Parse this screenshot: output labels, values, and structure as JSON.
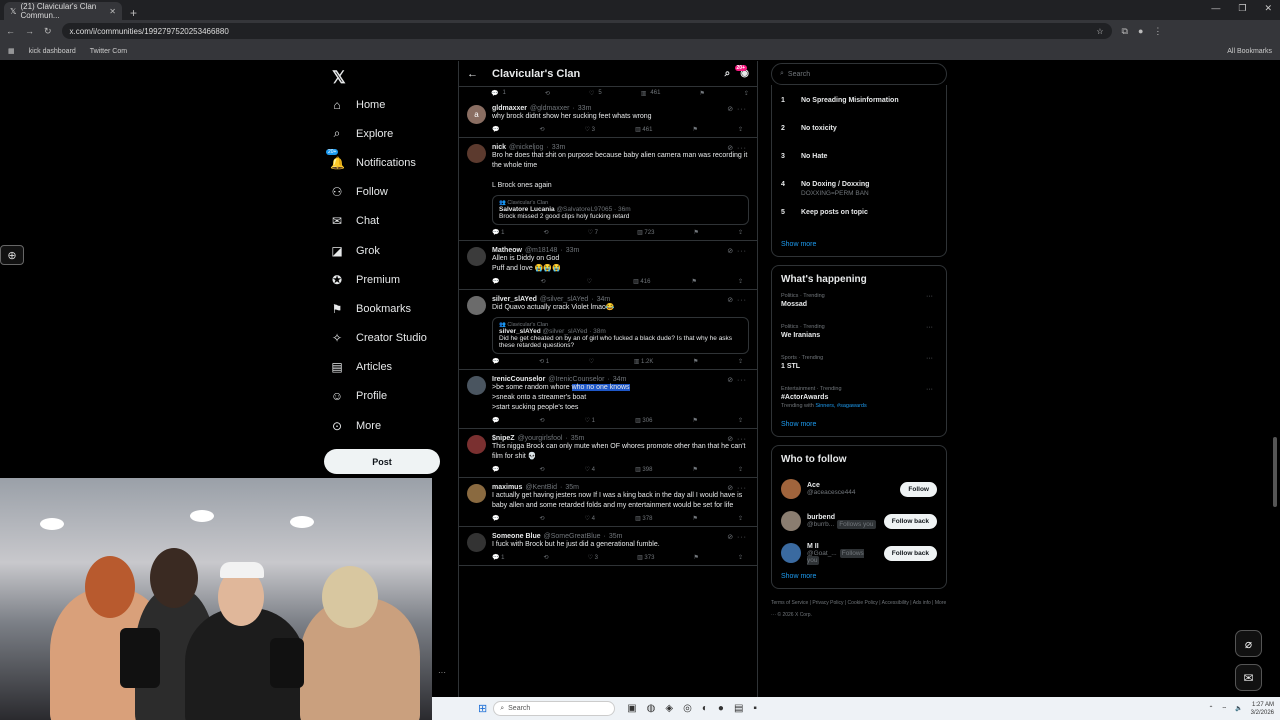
{
  "browser": {
    "tab_title": "(21) Clavicular's Clan Commun...",
    "url": "x.com/i/communities/1992797520253466880",
    "bookmarks": [
      "kick dashboard",
      "Twitter Com"
    ],
    "all_bookmarks": "All Bookmarks"
  },
  "nav": {
    "items": [
      {
        "label": "Home",
        "icon": "home-icon"
      },
      {
        "label": "Explore",
        "icon": "search-icon"
      },
      {
        "label": "Notifications",
        "icon": "bell-icon",
        "badge": "20+"
      },
      {
        "label": "Follow",
        "icon": "person-plus-icon"
      },
      {
        "label": "Chat",
        "icon": "mail-icon"
      },
      {
        "label": "Grok",
        "icon": "grok-icon"
      },
      {
        "label": "Premium",
        "icon": "premium-icon"
      },
      {
        "label": "Bookmarks",
        "icon": "bookmark-icon"
      },
      {
        "label": "Creator Studio",
        "icon": "lightbulb-icon"
      },
      {
        "label": "Articles",
        "icon": "article-icon"
      },
      {
        "label": "Profile",
        "icon": "person-icon"
      },
      {
        "label": "More",
        "icon": "more-icon"
      }
    ],
    "post_label": "Post"
  },
  "feed": {
    "title": "Clavicular's Clan",
    "hot_badge": "20+",
    "top_actions": {
      "replies": "1",
      "likes": "5",
      "views": "461"
    },
    "tweets": [
      {
        "name": "gldmaxxer",
        "handle": "@gldmaxxer",
        "time": "33m",
        "text": "why brock didnt show her sucking feet whats wrong",
        "avatar_letter": "a",
        "avatar_color": "#8a6e62",
        "replies": "",
        "reposts": "",
        "likes": "3",
        "views": "461"
      },
      {
        "name": "nick",
        "handle": "@nickeljog",
        "time": "33m",
        "text": "Bro he does that shit on purpose because baby alien camera man was recording it the whole time\n\nL Brock ones again",
        "avatar_letter": "",
        "avatar_color": "#5c3a2e",
        "quote": {
          "community": "Clavicular's Clan",
          "name": "Salvatore Lucania",
          "handle": "@SalvatoreL97065",
          "time": "36m",
          "text": "Brock missed 2 good clips holy fucking retard"
        },
        "replies": "1",
        "reposts": "",
        "likes": "7",
        "views": "723"
      },
      {
        "name": "Matheow",
        "handle": "@m18148",
        "time": "33m",
        "text": "Allen is Diddy on God\nPuff and love 😭😭😭",
        "avatar_letter": "",
        "avatar_color": "#3b3b3b",
        "replies": "",
        "reposts": "",
        "likes": "",
        "views": "416"
      },
      {
        "name": "silver_slAYed",
        "handle": "@silver_slAYed",
        "time": "34m",
        "text": "Did Quavo actually crack Violet lmao😂",
        "avatar_letter": "",
        "avatar_color": "#6b6b6b",
        "quote": {
          "community": "Clavicular's Clan",
          "name": "silver_slAYed",
          "handle": "@silver_slAYed",
          "time": "38m",
          "text": "Did he get cheated on by an of girl who fucked a black dude? Is that why he asks these retarded questions?"
        },
        "replies": "",
        "reposts": "1",
        "likes": "",
        "views": "1.2K"
      },
      {
        "name": "IrenicCounselor",
        "handle": "@IrenicCounselor",
        "time": "34m",
        "text_pre": ">be some random whore ",
        "text_hl": "who no one knows",
        "text_post": "\n>sneak onto a streamer's boat\n>start sucking people's toes",
        "avatar_letter": "",
        "avatar_color": "#4a5560",
        "replies": "",
        "reposts": "",
        "likes": "1",
        "views": "306"
      },
      {
        "name": "$nipeZ",
        "handle": "@yourgirlsfool",
        "time": "35m",
        "text": "This nigga Brock can only mute when OF whores promote other than that he can't film for shit 💀",
        "avatar_letter": "",
        "avatar_color": "#7a3030",
        "replies": "",
        "reposts": "",
        "likes": "4",
        "views": "398"
      },
      {
        "name": "maximus",
        "handle": "@KentBid",
        "time": "35m",
        "text": "I actually get having jesters now If I was a king back in the day all I would have is baby allen and some retarded folds and my entertainment would be set for life",
        "avatar_letter": "",
        "avatar_color": "#8a6a40",
        "replies": "",
        "reposts": "",
        "likes": "4",
        "views": "378"
      },
      {
        "name": "Someone Blue",
        "handle": "@SomeGreatBlue",
        "time": "35m",
        "text": "I fuck with Brock but he just did a generational fumble.",
        "avatar_letter": "",
        "avatar_color": "#333",
        "replies": "1",
        "reposts": "",
        "likes": "3",
        "views": "373"
      }
    ]
  },
  "side": {
    "search_placeholder": "Search",
    "rules": [
      {
        "n": "1",
        "title": "No Spreading Misinformation",
        "sub": ""
      },
      {
        "n": "2",
        "title": "No toxicity",
        "sub": ""
      },
      {
        "n": "3",
        "title": "No Hate",
        "sub": ""
      },
      {
        "n": "4",
        "title": "No Doxing / Doxxing",
        "sub": "DOXXING=PERM BAN"
      },
      {
        "n": "5",
        "title": "Keep posts on topic",
        "sub": ""
      }
    ],
    "show_more": "Show more",
    "happening_title": "What's happening",
    "trends": [
      {
        "cat": "Politics · Trending",
        "name": "Mossad",
        "sub": "",
        "links": ""
      },
      {
        "cat": "Politics · Trending",
        "name": "We Iranians",
        "sub": "",
        "links": ""
      },
      {
        "cat": "Sports · Trending",
        "name": "1 STL",
        "sub": "",
        "links": ""
      },
      {
        "cat": "Entertainment · Trending",
        "name": "#ActorAwards",
        "sub": "Trending with ",
        "links": "Sinners, #sagawards"
      }
    ],
    "wtf_title": "Who to follow",
    "wtf": [
      {
        "name": "Ace",
        "handle": "@aceacesce444",
        "follows_you": "",
        "btn": "Follow",
        "color": "#a0643c"
      },
      {
        "name": "burbend",
        "handle": "@burrb...",
        "follows_you": "Follows you",
        "btn": "Follow back",
        "color": "#8a7d70"
      },
      {
        "name": "M II",
        "handle": "@Goat_...",
        "follows_you": "Follows you",
        "btn": "Follow back",
        "color": "#3a6aa0"
      }
    ],
    "footer": [
      "Terms of Service",
      "|",
      "Privacy Policy",
      "|",
      "Cookie Policy",
      "|",
      "Accessibility",
      "|",
      "Ads info",
      "|",
      "More ···",
      "© 2026 X Corp."
    ]
  },
  "taskbar": {
    "search": "Search",
    "time": "1:27 AM",
    "date": "3/2/2026"
  }
}
